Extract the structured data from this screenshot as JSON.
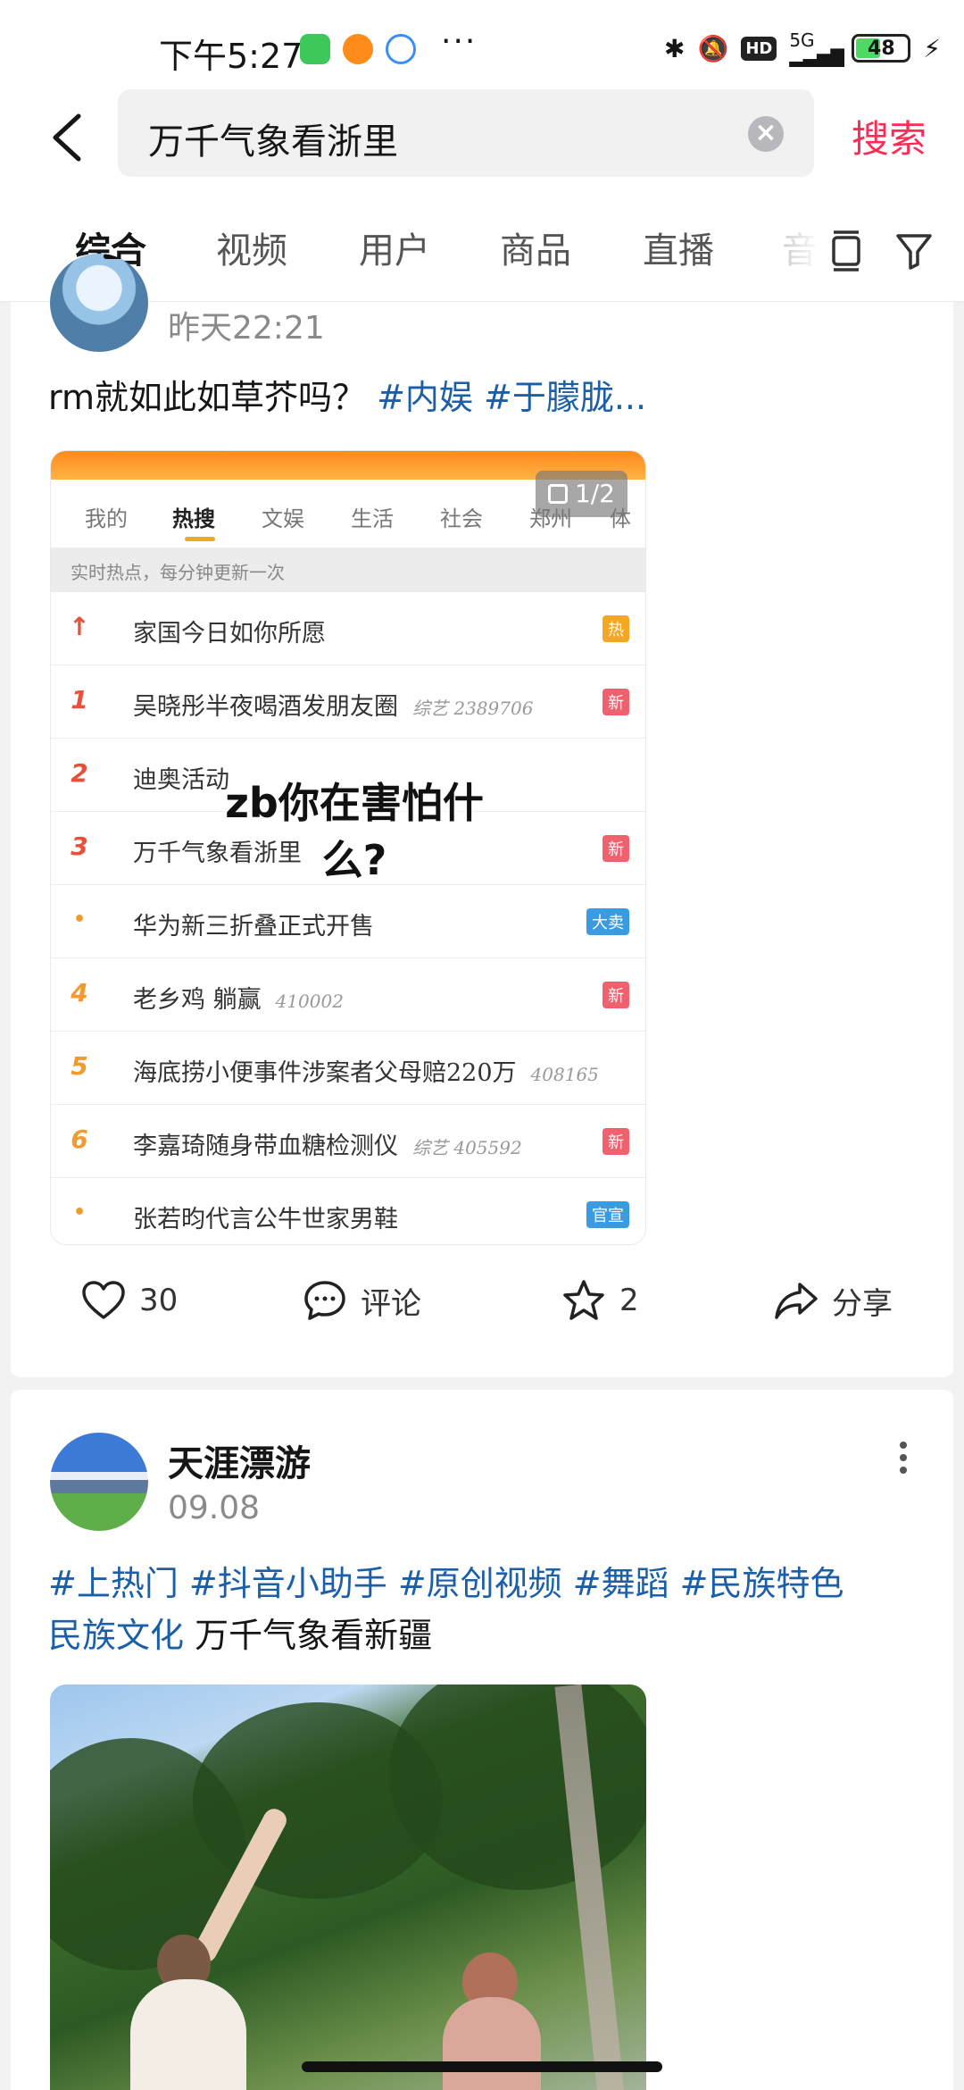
{
  "status_bar": {
    "time": "下午5:27",
    "network": "5G",
    "battery": "48"
  },
  "search": {
    "query": "万千气象看浙里",
    "button_label": "搜索"
  },
  "tabs": [
    {
      "label": "综合",
      "active": true
    },
    {
      "label": "视频"
    },
    {
      "label": "用户"
    },
    {
      "label": "商品"
    },
    {
      "label": "直播"
    },
    {
      "label": "音"
    }
  ],
  "post1": {
    "time": "昨天22:21",
    "text": "rm就如此如草芥吗？",
    "tags": [
      "#内娱",
      "#于朦胧..."
    ],
    "image": {
      "page_indicator": "1/2",
      "tabs": [
        "我的",
        "热搜",
        "文娱",
        "生活",
        "社会",
        "郑州",
        "体"
      ],
      "subheader": "实时热点，每分钟更新一次",
      "rows": [
        {
          "rank": "↑",
          "title": "家国今日如你所愿",
          "meta": "",
          "badge": "热"
        },
        {
          "rank": "1",
          "title": "吴晓彤半夜喝酒发朋友圈",
          "meta": "综艺 2389706",
          "badge": "新"
        },
        {
          "rank": "2",
          "title": "迪奥活动",
          "meta": "",
          "badge": ""
        },
        {
          "rank": "3",
          "title": "万千气象看浙里",
          "meta": "",
          "badge": "新"
        },
        {
          "rank": "•",
          "title": "华为新三折叠正式开售",
          "meta": "",
          "badge": "大卖"
        },
        {
          "rank": "4",
          "title": "老乡鸡 躺赢",
          "meta": "410002",
          "badge": "新"
        },
        {
          "rank": "5",
          "title": "海底捞小便事件涉案者父母赔220万",
          "meta": "408165",
          "badge": ""
        },
        {
          "rank": "6",
          "title": "李嘉琦随身带血糖检测仪",
          "meta": "综艺 405592",
          "badge": "新"
        },
        {
          "rank": "•",
          "title": "张若昀代言公牛世家男鞋",
          "meta": "",
          "badge": "官宣"
        }
      ],
      "overlay": "zb你在害怕什么?"
    },
    "actions": {
      "likes": "30",
      "comment_label": "评论",
      "favorites": "2",
      "share_label": "分享"
    }
  },
  "post2": {
    "author": "天涯漂游",
    "date": "09.08",
    "tags_line1": "#上热门 #抖音小助手 #原创视频 #舞蹈 #民族特色",
    "tags_line2": "民族文化",
    "text_tail": " 万千气象看新疆"
  },
  "colors": {
    "accent": "#fe2c55",
    "hashtag": "#1b5fa8"
  }
}
